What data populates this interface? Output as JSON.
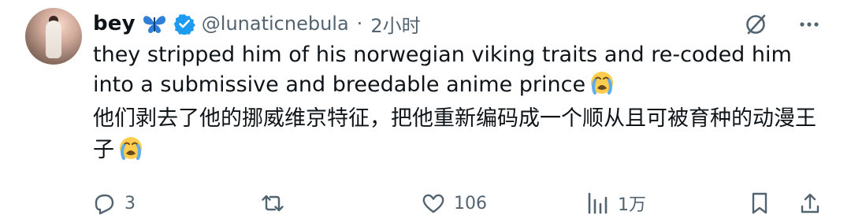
{
  "author": {
    "name": "bey",
    "handle": "@lunaticnebula",
    "separator": "·",
    "time": "2小时",
    "verified": true,
    "name_emoji": "butterfly-emoji"
  },
  "tweet": {
    "text_en": "they stripped him of his norwegian viking traits and re-coded him into a submissive and breedable anime prince",
    "text_zh": "他们剥去了他的挪威维京特征，把他重新编码成一个顺从且可被育种的动漫王子",
    "emoji": "loudly-crying-face"
  },
  "actions": {
    "reply_count": "3",
    "retweet_count": "",
    "like_count": "106",
    "view_count": "1万"
  },
  "colors": {
    "text": "#0f1419",
    "muted": "#536471",
    "verified": "#1d9bf0",
    "butterfly": "#2f7fd6"
  },
  "icons": {
    "top_right": [
      "grok-icon",
      "more-icon"
    ],
    "actions": [
      "reply-icon",
      "retweet-icon",
      "like-icon",
      "views-icon",
      "bookmark-icon",
      "share-icon"
    ]
  }
}
